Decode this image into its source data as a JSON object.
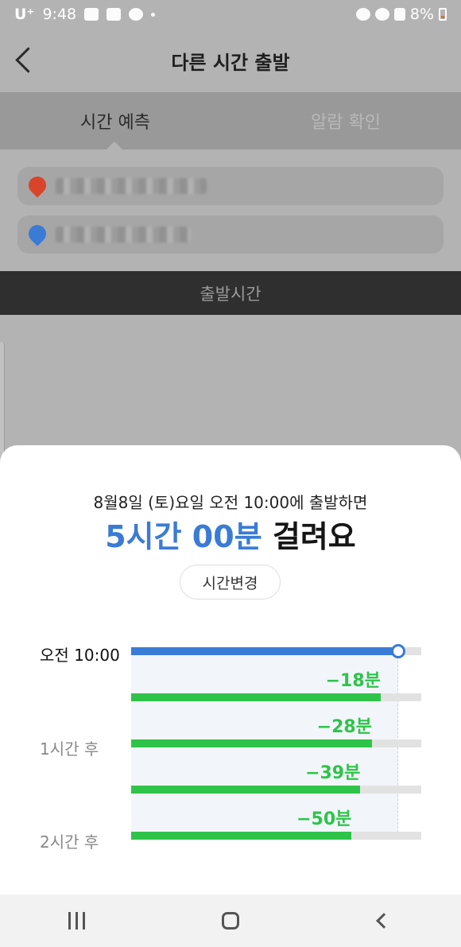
{
  "status_bar": {
    "carrier": "U⁺",
    "time": "9:48",
    "battery": "8%"
  },
  "header": {
    "title": "다른 시간 출발"
  },
  "tabs": [
    {
      "label": "시간 예측",
      "active": true
    },
    {
      "label": "알람 확인",
      "active": false
    }
  ],
  "route": {
    "origin_pin_color": "#d9452b",
    "dest_pin_color": "#3a7bd5"
  },
  "depart_bar": {
    "label": "출발시간"
  },
  "sheet": {
    "description": "8월8일 (토)요일 오전 10:00에 출발하면",
    "duration_value": "5시간 00분",
    "duration_suffix": "걸려요",
    "change_button": "시간변경"
  },
  "chart_data": {
    "type": "bar",
    "row_labels": [
      "오전 10:00",
      "1시간 후",
      "2시간 후"
    ],
    "bars": [
      {
        "delta": "",
        "fill": 0.92,
        "color": "#3a7bd5"
      },
      {
        "delta": "−18분",
        "fill": 0.86,
        "color": "#2fc34a"
      },
      {
        "delta": "−28분",
        "fill": 0.83,
        "color": "#2fc34a"
      },
      {
        "delta": "−39분",
        "fill": 0.79,
        "color": "#2fc34a"
      },
      {
        "delta": "−50분",
        "fill": 0.76,
        "color": "#2fc34a"
      }
    ]
  },
  "colors": {
    "accent": "#3a7bd5",
    "positive": "#2fc34a"
  }
}
